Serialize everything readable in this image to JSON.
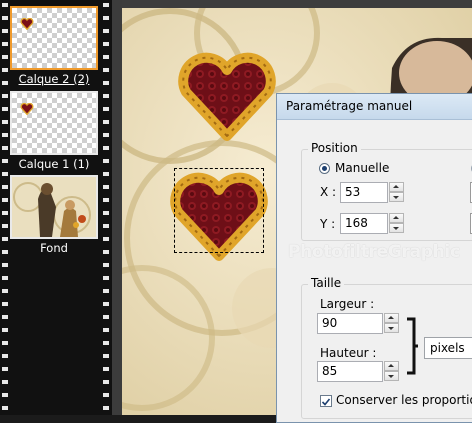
{
  "layers": [
    {
      "label": "Calque 2 (2)",
      "selected": true
    },
    {
      "label": "Calque 1 (1)",
      "selected": false
    },
    {
      "label": "Fond",
      "selected": false
    }
  ],
  "dialog": {
    "title": "Paramétrage manuel",
    "position": {
      "group_title": "Position",
      "manual_label": "Manuelle",
      "x_label": "X :",
      "x_value": "53",
      "y_label": "Y :",
      "y_value": "168"
    },
    "size": {
      "group_title": "Taille",
      "width_label": "Largeur :",
      "width_value": "90",
      "height_label": "Hauteur :",
      "height_value": "85",
      "unit": "pixels",
      "keep_proportions_label": "Conserver les proportions",
      "keep_proportions_checked": true
    }
  },
  "watermark": "PhotofiltreGraphic",
  "colors": {
    "selected_layer_border": "#f09a2b",
    "canvas_beige": "#ece0bf",
    "heart_red": "#7a1018",
    "heart_gold": "#e0a52a"
  }
}
